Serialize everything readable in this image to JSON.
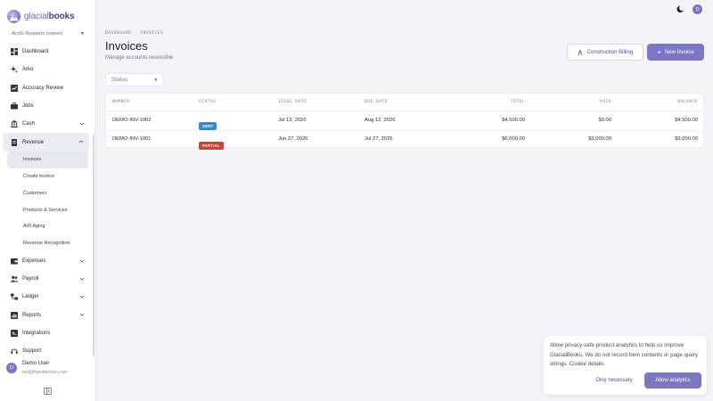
{
  "brand": {
    "name_part1": "glacial",
    "name_part2": "books"
  },
  "org": {
    "name": "Arctic Roasters (owner)"
  },
  "sidebar": {
    "items": [
      {
        "label": "Dashboard",
        "icon": "dashboard-icon"
      },
      {
        "label": "Arko",
        "icon": "sparkle-icon"
      },
      {
        "label": "Accuracy Review",
        "icon": "chart-icon"
      },
      {
        "label": "Jobs",
        "icon": "briefcase-icon"
      },
      {
        "label": "Cash",
        "icon": "bank-icon"
      },
      {
        "label": "Revenue",
        "icon": "receipt-icon"
      },
      {
        "label": "Expenses",
        "icon": "wallet-icon"
      },
      {
        "label": "Payroll",
        "icon": "people-icon"
      },
      {
        "label": "Ledger",
        "icon": "ledger-icon"
      },
      {
        "label": "Reports",
        "icon": "report-icon"
      },
      {
        "label": "Integrations",
        "icon": "plug-icon"
      },
      {
        "label": "Support",
        "icon": "support-icon"
      }
    ],
    "revenue_sub": [
      {
        "label": "Invoices"
      },
      {
        "label": "Create invoice"
      },
      {
        "label": "Customers"
      },
      {
        "label": "Products & Services"
      },
      {
        "label": "A/R Aging"
      },
      {
        "label": "Revenue Recognition"
      }
    ]
  },
  "user": {
    "initial": "D",
    "name": "Demo User",
    "email": "test@fuentberrien.com"
  },
  "topbar": {
    "avatar_initial": "D"
  },
  "breadcrumb": {
    "root": "DASHBOARD",
    "sep": " · ",
    "current": "INVOICES"
  },
  "page": {
    "title": "Invoices",
    "subtitle": "Manage accounts receivable",
    "construction_button": "Construction Billing",
    "new_button": "New Invoice",
    "status_placeholder": "Status"
  },
  "table": {
    "headers": {
      "number": "NUMBER",
      "status": "STATUS",
      "issue_date": "ISSUE DATE",
      "due_date": "DUE DATE",
      "total": "TOTAL",
      "paid": "PAID",
      "balance": "BALANCE"
    },
    "rows": [
      {
        "number": "DEMO-INV-1002",
        "status": "SENT",
        "issue_date": "Jul 13, 2026",
        "due_date": "Aug 12, 2026",
        "total": "$4,500.00",
        "paid": "$0.00",
        "balance": "$4,500.00"
      },
      {
        "number": "DEMO-INV-1001",
        "status": "PARTIAL",
        "issue_date": "Jun 27, 2026",
        "due_date": "Jul 27, 2026",
        "total": "$6,000.00",
        "paid": "$3,000.00",
        "balance": "$3,000.00"
      }
    ]
  },
  "cookie": {
    "text": "Allow privacy-safe product analytics to help us improve GlacialBooks. We do not record form contents or page query strings.",
    "details_link": "Cookie details",
    "only_necessary": "Only necessary",
    "allow": "Allow analytics"
  },
  "colors": {
    "accent": "#7c77c2",
    "sent": "#3f86c4",
    "partial": "#c4453c"
  }
}
